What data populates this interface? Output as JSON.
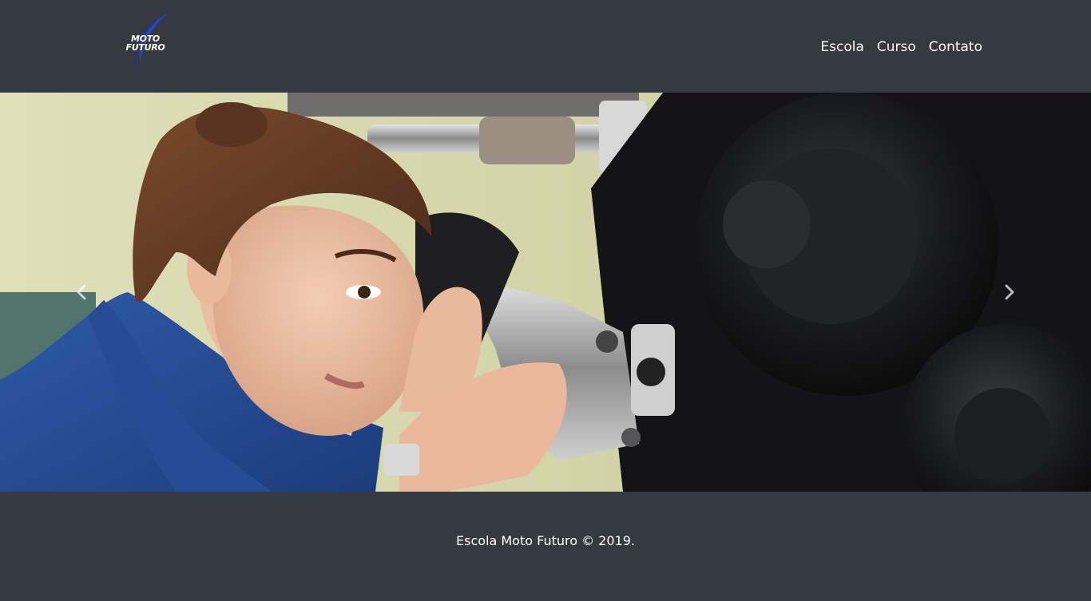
{
  "header": {
    "logo": {
      "line1": "MOTO",
      "line2": "FUTURO"
    },
    "nav": [
      {
        "label": "Escola"
      },
      {
        "label": "Curso"
      },
      {
        "label": "Contato"
      }
    ]
  },
  "carousel": {
    "image": "photo-woman-mechanic-working-on-motorcycle",
    "prev_icon": "chevron-left-icon",
    "next_icon": "chevron-right-icon"
  },
  "footer": {
    "text": "Escola Moto Futuro © 2019."
  },
  "colors": {
    "background": "#343a40",
    "text": "#ffffff",
    "logo_swoosh": "#1a2fa8"
  }
}
